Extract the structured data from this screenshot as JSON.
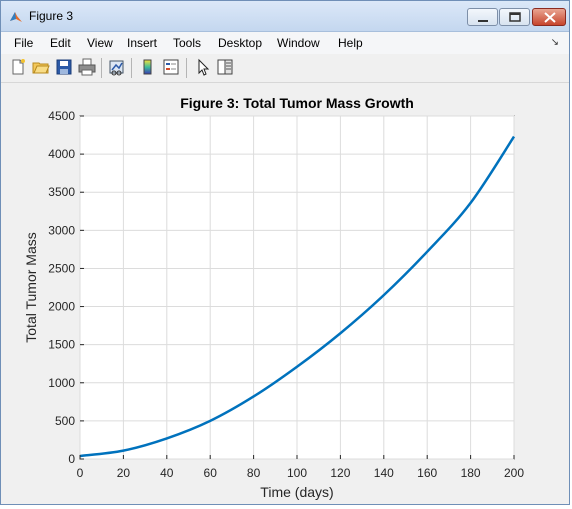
{
  "window": {
    "title": "Figure 3"
  },
  "menu": [
    "File",
    "Edit",
    "View",
    "Insert",
    "Tools",
    "Desktop",
    "Window",
    "Help"
  ],
  "toolbar": {
    "buttons": [
      "new-figure",
      "open-file",
      "save",
      "print",
      "link-plot",
      "insert-colorbar",
      "insert-legend",
      "edit-plot",
      "show-plot-tools"
    ]
  },
  "chart_data": {
    "type": "line",
    "title": "Figure 3: Total Tumor Mass Growth",
    "xlabel": "Time (days)",
    "ylabel": "Total Tumor Mass",
    "xlim": [
      0,
      200
    ],
    "ylim": [
      0,
      4500
    ],
    "xticks": [
      "0",
      "20",
      "40",
      "60",
      "80",
      "100",
      "120",
      "140",
      "160",
      "180",
      "200"
    ],
    "yticks": [
      "0",
      "500",
      "1000",
      "1500",
      "2000",
      "2500",
      "3000",
      "3500",
      "4000",
      "4500"
    ],
    "grid": true,
    "color": "#0072bd",
    "series": [
      {
        "x": [
          0,
          20,
          40,
          60,
          80,
          100,
          120,
          140,
          160,
          180,
          200
        ],
        "y": [
          40,
          110,
          270,
          500,
          820,
          1210,
          1650,
          2150,
          2720,
          3360,
          4230
        ]
      }
    ]
  }
}
